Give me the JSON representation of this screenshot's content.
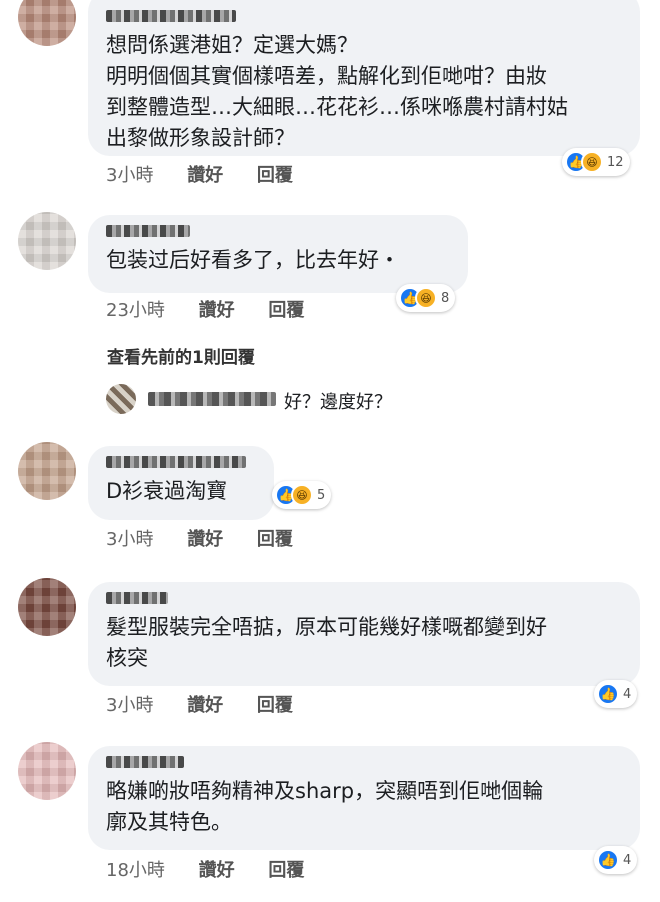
{
  "labels": {
    "like": "讚好",
    "reply": "回覆"
  },
  "comments": [
    {
      "text": "想問係選港姐？定選大媽？\n明明個個其實個樣唔差，點解化到佢哋咁？由妝\n到整體造型…大細眼…花花衫…係咪喺農村請村姑\n出黎做形象設計師？",
      "time": "3小時",
      "reactions": [
        "like",
        "haha"
      ],
      "count": "12"
    },
    {
      "text": "包装过后好看多了，比去年好・",
      "time": "23小時",
      "reactions": [
        "like",
        "haha"
      ],
      "count": "8"
    },
    {
      "text": "D衫衰過淘寶",
      "time": "3小時",
      "reactions": [
        "like",
        "haha"
      ],
      "count": "5"
    },
    {
      "text": "髮型服裝完全唔掂，原本可能幾好樣嘅都變到好\n核突",
      "time": "3小時",
      "reactions": [
        "like"
      ],
      "count": "4"
    },
    {
      "text": "略嫌啲妝唔夠精神及sharp，突顯唔到佢哋個輪\n廓及其特色。",
      "time": "18小時",
      "reactions": [
        "like"
      ],
      "count": "4"
    }
  ],
  "previous_replies_link": "查看先前的1則回覆",
  "reply_preview": {
    "text": "好？邊度好？"
  }
}
